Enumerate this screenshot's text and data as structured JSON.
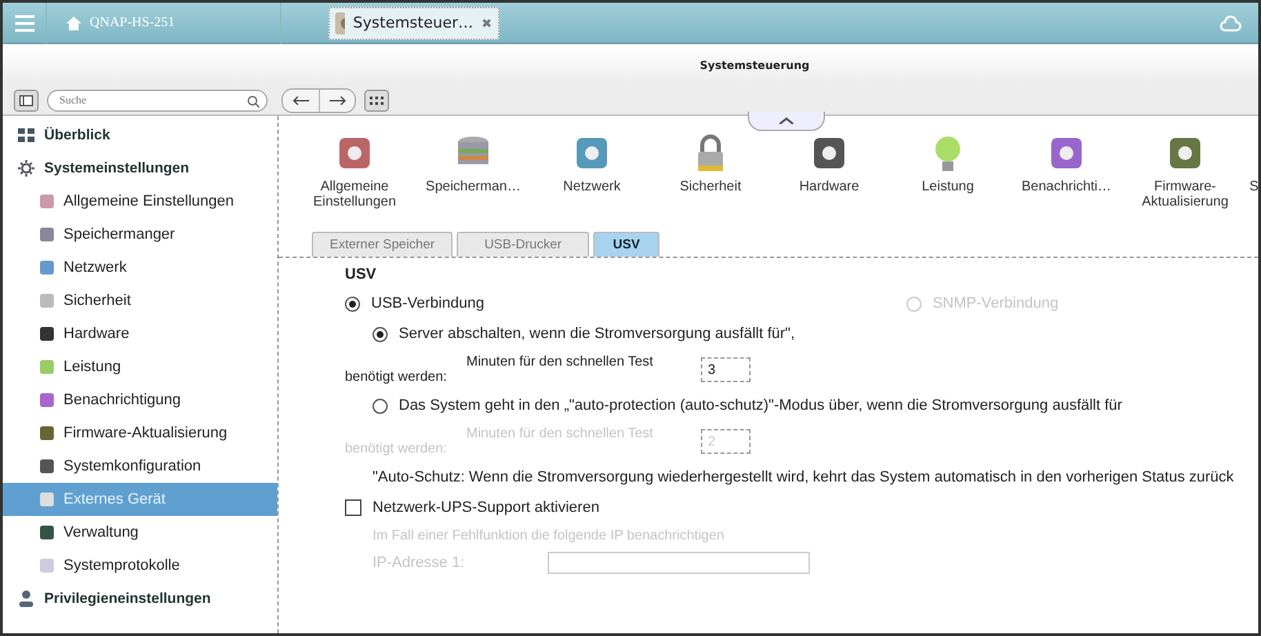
{
  "topbar": {
    "home_label": "QNAP-HS-251",
    "tab_label": "Systemsteuer…",
    "close": "✖"
  },
  "app_title": "Systemsteuerung",
  "search": {
    "placeholder": "Suche"
  },
  "sidebar": {
    "items": [
      {
        "label": "Überblick",
        "selected": false
      },
      {
        "label": "Systemeinstellungen",
        "selected": false,
        "children": [
          {
            "label": "Allgemeine Einstellungen",
            "selected": false
          },
          {
            "label": "Speichermanger",
            "selected": false
          },
          {
            "label": "Netzwerk",
            "selected": false
          },
          {
            "label": "Sicherheit",
            "selected": false
          },
          {
            "label": "Hardware",
            "selected": false
          },
          {
            "label": "Leistung",
            "selected": false
          },
          {
            "label": "Benachrichtigung",
            "selected": false
          },
          {
            "label": "Firmware-Aktualisierung",
            "selected": false
          },
          {
            "label": "Systemkonfiguration",
            "selected": false
          },
          {
            "label": "Externes Gerät",
            "selected": true
          },
          {
            "label": "Verwaltung",
            "selected": false
          },
          {
            "label": "Systemprotokolle",
            "selected": false
          }
        ]
      },
      {
        "label": "Privilegieneinstellungen",
        "selected": false
      }
    ]
  },
  "icon_bar": [
    {
      "label": "Allgemeine Einstellungen"
    },
    {
      "label": "Speicherman…"
    },
    {
      "label": "Netzwerk"
    },
    {
      "label": "Sicherheit"
    },
    {
      "label": "Hardware"
    },
    {
      "label": "Leistung"
    },
    {
      "label": "Benachrichti…"
    },
    {
      "label": "Firmware-Aktualisierung"
    },
    {
      "label": "S"
    }
  ],
  "tabs": [
    {
      "label": "Externer Speicher",
      "selected": false
    },
    {
      "label": "USB-Drucker",
      "selected": false
    },
    {
      "label": "USV",
      "selected": true
    }
  ],
  "section_title": "USV",
  "rows": [
    {
      "kind": "radio",
      "label": "USB-Verbindung",
      "selected": true,
      "disabled": false,
      "side": {
        "label": "SNMP-Verbindung",
        "selected": false,
        "disabled": true
      }
    },
    {
      "kind": "subradio",
      "label": "Server abschalten, wenn die Stromversorgung ausfällt für\",",
      "selected": true,
      "disabled": false
    },
    {
      "kind": "minutes",
      "label": "Minuten für den schnellen Test benötigt werden:",
      "value": "3",
      "disabled": false
    },
    {
      "kind": "subradio",
      "label": "Das System geht in den „\"auto-protection (auto-schutz)\"-Modus über, wenn die Stromversorgung ausfällt für",
      "selected": false,
      "disabled": false
    },
    {
      "kind": "minutes",
      "label": "Minuten für den schnellen Test benötigt werden:",
      "value": "2",
      "disabled": true
    },
    {
      "kind": "note",
      "label": "\"Auto-Schutz: Wenn die Stromversorgung wiederhergestellt wird, kehrt das System automatisch in den vorherigen Status zurück"
    },
    {
      "kind": "checkbox",
      "label": "Netzwerk-UPS-Support aktivieren",
      "checked": false
    },
    {
      "kind": "hint",
      "label": "Im Fall einer Fehlfunktion die folgende IP benachrichtigen"
    },
    {
      "kind": "ip",
      "label": "IP-Adresse 1:",
      "disabled": true
    }
  ]
}
